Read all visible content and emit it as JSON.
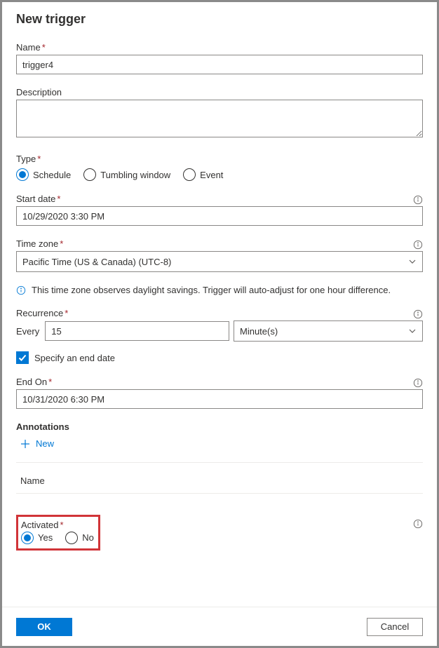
{
  "title": "New trigger",
  "labels": {
    "name": "Name",
    "description": "Description",
    "type": "Type",
    "start_date": "Start date",
    "time_zone": "Time zone",
    "recurrence": "Recurrence",
    "every": "Every",
    "specify_end": "Specify an end date",
    "end_on": "End On",
    "annotations": "Annotations",
    "annotations_new": "New",
    "annotations_name": "Name",
    "activated": "Activated",
    "req": "*"
  },
  "values": {
    "name": "trigger4",
    "description": "",
    "start_date": "10/29/2020 3:30 PM",
    "time_zone": "Pacific Time (US & Canada) (UTC-8)",
    "recurrence_value": "15",
    "recurrence_unit": "Minute(s)",
    "end_on": "10/31/2020 6:30 PM"
  },
  "type_options": {
    "schedule": "Schedule",
    "tumbling": "Tumbling window",
    "event": "Event",
    "selected": "schedule"
  },
  "activated_options": {
    "yes": "Yes",
    "no": "No",
    "selected": "yes"
  },
  "dst_note": "This time zone observes daylight savings. Trigger will auto-adjust for one hour difference.",
  "footer": {
    "ok": "OK",
    "cancel": "Cancel"
  }
}
